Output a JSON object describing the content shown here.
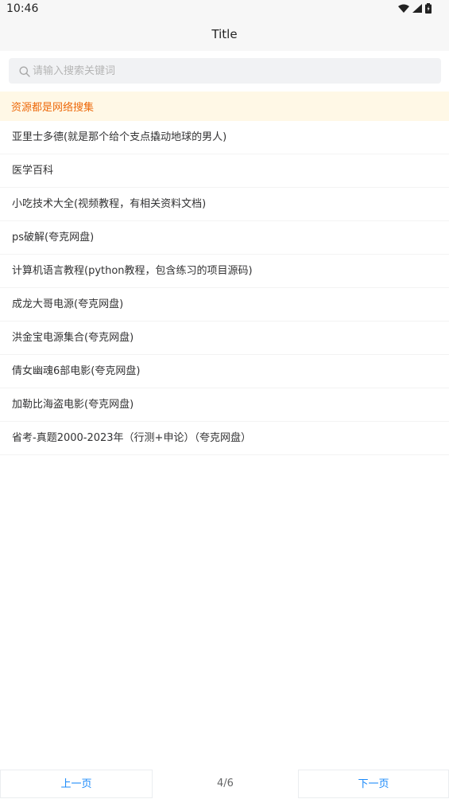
{
  "status_bar": {
    "time": "10:46",
    "icons": [
      "wifi-icon",
      "signal-icon",
      "battery-icon"
    ]
  },
  "header": {
    "title": "Title"
  },
  "search": {
    "placeholder": "请输入搜索关键词",
    "value": "",
    "icon": "search-icon"
  },
  "notice": {
    "text": "资源都是网络搜集"
  },
  "list": {
    "items": [
      "亚里士多德(就是那个给个支点撬动地球的男人)",
      "医学百科",
      "小吃技术大全(视频教程，有相关资料文档)",
      "ps破解(夸克网盘)",
      "计算机语言教程(python教程，包含练习的项目源码)",
      "成龙大哥电源(夸克网盘)",
      "洪金宝电源集合(夸克网盘)",
      "倩女幽魂6部电影(夸克网盘)",
      "加勒比海盗电影(夸克网盘)",
      "省考-真题2000-2023年（行测+申论）（夸克网盘）"
    ]
  },
  "pagination": {
    "prev_label": "上一页",
    "page_desc": "4/6",
    "next_label": "下一页"
  },
  "colors": {
    "accent": "#1989fa",
    "notice_text": "#ed6a0c",
    "notice_bg": "#fff8e6"
  }
}
